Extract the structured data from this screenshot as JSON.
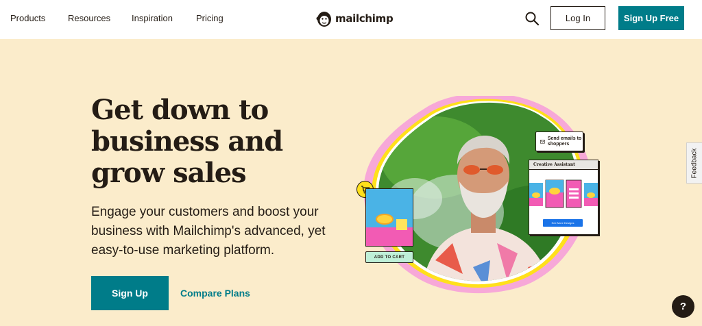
{
  "header": {
    "nav": [
      {
        "label": "Products"
      },
      {
        "label": "Resources"
      },
      {
        "label": "Inspiration"
      },
      {
        "label": "Pricing"
      }
    ],
    "logo_text": "mailchimp",
    "login_label": "Log In",
    "signup_free_label": "Sign Up Free"
  },
  "hero": {
    "title": "Get down to business and grow sales",
    "subtitle": "Engage your customers and boost your business with Mailchimp's advanced, yet easy-to-use marketing platform.",
    "signup_label": "Sign Up",
    "compare_label": "Compare Plans"
  },
  "illustration": {
    "add_to_cart": "ADD TO CART",
    "send_emails": "Send emails to shoppers",
    "creative_assistant": "Creative Assistant",
    "see_more": "See More Designs"
  },
  "feedback_label": "Feedback",
  "help_label": "?",
  "colors": {
    "brand_teal": "#007c89",
    "background": "#fbeccb",
    "text": "#241c15",
    "pink": "#f25bb4",
    "yellow": "#ffe01b"
  }
}
